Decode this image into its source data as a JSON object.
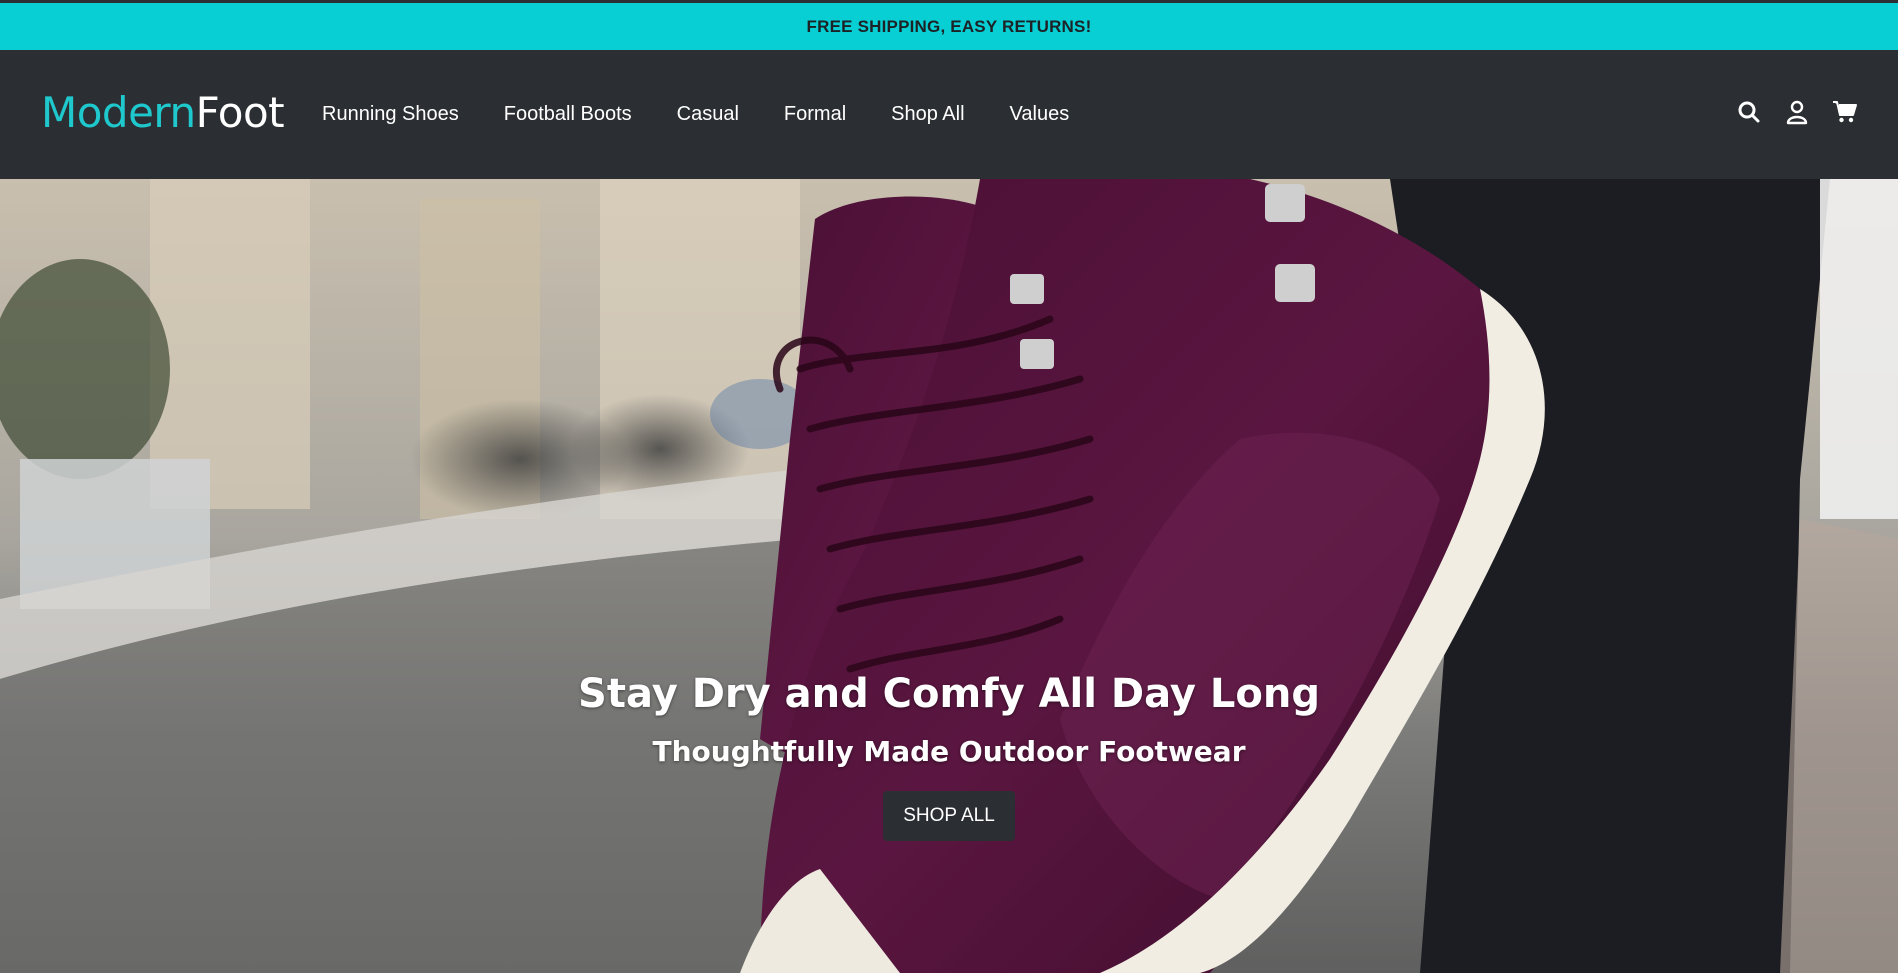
{
  "announcement": "FREE SHIPPING, EASY RETURNS!",
  "brand": {
    "part1": "Modern",
    "part2": "Foot",
    "accent": "#1ec8cc"
  },
  "nav": [
    {
      "label": "Running Shoes"
    },
    {
      "label": "Football Boots"
    },
    {
      "label": "Casual"
    },
    {
      "label": "Formal"
    },
    {
      "label": "Shop All"
    },
    {
      "label": "Values"
    }
  ],
  "header_icons": [
    "search-icon",
    "account-icon",
    "cart-icon"
  ],
  "hero": {
    "title": "Stay Dry and Comfy All Day Long",
    "subtitle": "Thoughtfully Made Outdoor Footwear",
    "cta": "SHOP ALL",
    "image": "purple-sneaker-photo"
  },
  "colors": {
    "topbar": "#08cfd4",
    "header": "#2b2f33",
    "shoe": "#5a1640"
  }
}
